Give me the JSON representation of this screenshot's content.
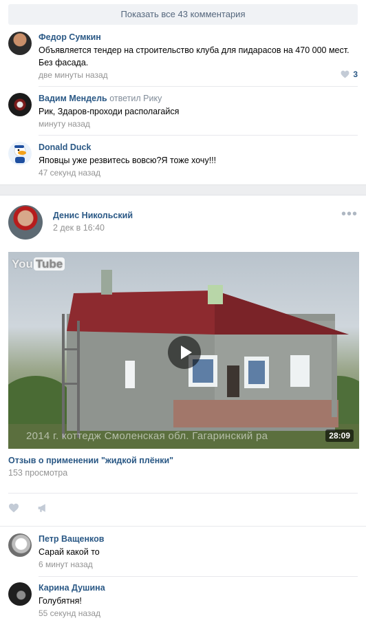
{
  "show_all": {
    "label": "Показать все 43 комментария"
  },
  "comments_top": [
    {
      "author": "Федор Сумкин",
      "text": "Объявляется тендер на строительство клуба для пидарасов на 470 000 мест. Без фасада.",
      "time": "две минуты назад",
      "likes": "3"
    },
    {
      "author": "Вадим Мендель",
      "reply_word": "ответил",
      "reply_to": "Рику",
      "text": "Рик, Здаров-проходи располагайся",
      "time": "минуту назад"
    },
    {
      "author": "Donald Duck",
      "text": "Яповцы уже резвитесь вовсю?Я тоже хочу!!!",
      "time": "47 секунд назад"
    }
  ],
  "post": {
    "author": "Денис Никольский",
    "date": "2 дек в 16:40",
    "menu": "•••",
    "video": {
      "logo_you": "You",
      "logo_tube": "Tube",
      "overlay_text": "2014 г. коттедж  Смоленская обл. Гагаринский ра",
      "duration": "28:09",
      "title": "Отзыв о применении \"жидкой плёнки\"",
      "views": "153 просмотра"
    }
  },
  "comments_bottom": [
    {
      "author": "Петр Ващенков",
      "text": "Сарай какой то",
      "time": "6 минут назад"
    },
    {
      "author": "Карина Душина",
      "text": "Голубятня!",
      "time": "55 секунд назад"
    }
  ],
  "colors": {
    "link": "#2a5885",
    "muted": "#939393",
    "icon": "#aeb7c2",
    "background": "#edeef0"
  }
}
